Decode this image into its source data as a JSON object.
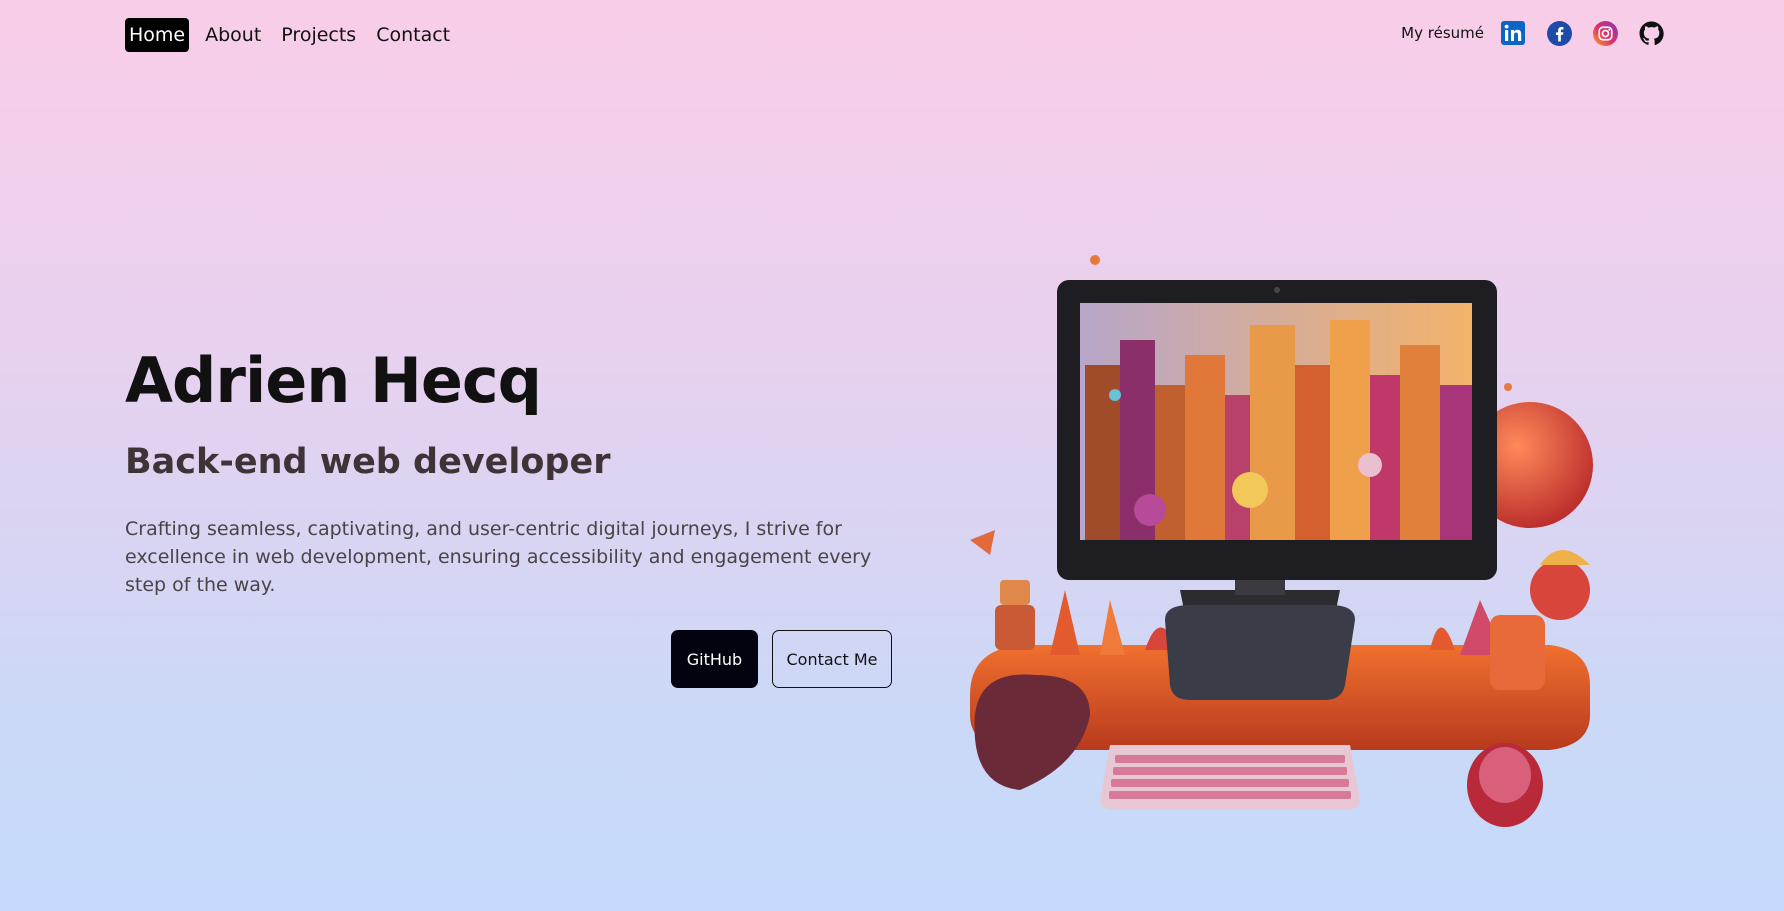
{
  "nav": {
    "items": [
      {
        "label": "Home",
        "active": true
      },
      {
        "label": "About",
        "active": false
      },
      {
        "label": "Projects",
        "active": false
      },
      {
        "label": "Contact",
        "active": false
      }
    ],
    "resume_label": "My résumé",
    "social": [
      {
        "icon": "linkedin-icon",
        "color": "#0a66c2"
      },
      {
        "icon": "facebook-icon",
        "color": "#1877f2"
      },
      {
        "icon": "instagram-icon",
        "color": "#c13584"
      },
      {
        "icon": "github-icon",
        "color": "#111111"
      }
    ]
  },
  "hero": {
    "name": "Adrien Hecq",
    "role": "Back-end web developer",
    "description": "Crafting seamless, captivating, and user-centric digital journeys, I strive for excellence in web development, ensuring accessibility and engagement every step of the way.",
    "github_button": "GitHub",
    "contact_button": "Contact Me"
  },
  "colors": {
    "background_top": "#f9cde8",
    "background_bottom": "#c4dafb",
    "primary_button": "#03030f"
  }
}
